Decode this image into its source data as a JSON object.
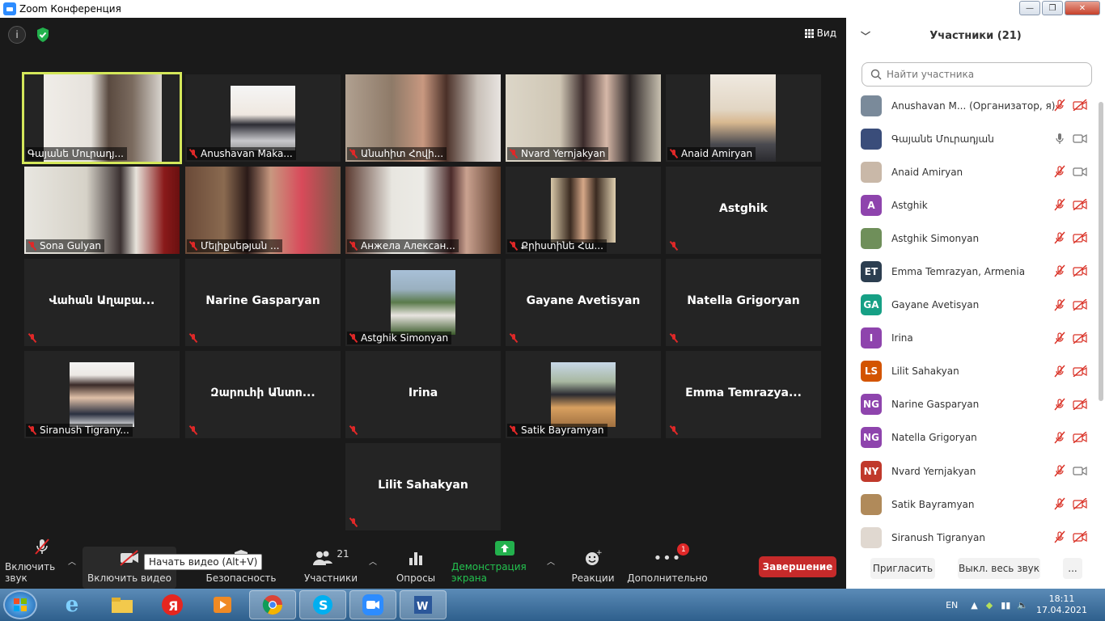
{
  "window": {
    "title": "Zoom Конференция",
    "minimize": "—",
    "maximize": "❐",
    "close": "✕"
  },
  "view_label": "Вид",
  "tiles": [
    {
      "name": "Գայանե Մուրադյ..."
    },
    {
      "name": "Anushavan Maka..."
    },
    {
      "name": "Անահիտ Հովի..."
    },
    {
      "name": "Nvard Yernjakyan"
    },
    {
      "name": "Anaid Amiryan"
    },
    {
      "name": "Sona Gulyan"
    },
    {
      "name": "Մելիքսեթյան ..."
    },
    {
      "name": "Анжела Алексан..."
    },
    {
      "name": "Քրիստինե Հա..."
    },
    {
      "name": "Astghik"
    },
    {
      "name": "Վահան Աղաբա..."
    },
    {
      "name": "Narine Gasparyan"
    },
    {
      "name": "Astghik Simonyan"
    },
    {
      "name": "Gayane Avetisyan"
    },
    {
      "name": "Natella Grigoryan"
    },
    {
      "name": "Siranush Tigrany..."
    },
    {
      "name": "Զարուհի Անտո..."
    },
    {
      "name": "Irina"
    },
    {
      "name": "Satik Bayramyan"
    },
    {
      "name": "Emma  Temrazya..."
    },
    {
      "name": "Lilit Sahakyan"
    }
  ],
  "toolbar": {
    "audio": "Включить звук",
    "video": "Включить видео",
    "tooltip": "Начать видео (Alt+V)",
    "security": "Безопасность",
    "participants": "Участники",
    "participants_count": "21",
    "polls": "Опросы",
    "share": "Демонстрация экрана",
    "reactions": "Реакции",
    "more": "Дополнительно",
    "more_badge": "1",
    "end": "Завершение"
  },
  "panel": {
    "title": "Участники (21)",
    "search_placeholder": "Найти участника",
    "participants": [
      {
        "name": "Anushavan M...  (Организатор, я)",
        "initials": "",
        "color": "#7a8a9a",
        "mic": "off",
        "video": "off"
      },
      {
        "name": "Գայանե Մուրադյան",
        "initials": "",
        "color": "#3a4d7a",
        "mic": "on",
        "video": "on"
      },
      {
        "name": "Anaid Amiryan",
        "initials": "",
        "color": "#c9b8a8",
        "mic": "off",
        "video": "on"
      },
      {
        "name": "Astghik",
        "initials": "A",
        "color": "#8e44ad",
        "mic": "off",
        "video": "off"
      },
      {
        "name": "Astghik Simonyan",
        "initials": "",
        "color": "#6f8f5a",
        "mic": "off",
        "video": "off"
      },
      {
        "name": "Emma  Temrazyan, Armenia",
        "initials": "ET",
        "color": "#2c3e50",
        "mic": "off",
        "video": "off"
      },
      {
        "name": "Gayane Avetisyan",
        "initials": "GA",
        "color": "#16a085",
        "mic": "off",
        "video": "off"
      },
      {
        "name": "Irina",
        "initials": "I",
        "color": "#8e44ad",
        "mic": "off",
        "video": "off"
      },
      {
        "name": "Lilit Sahakyan",
        "initials": "LS",
        "color": "#d35400",
        "mic": "off",
        "video": "off"
      },
      {
        "name": "Narine Gasparyan",
        "initials": "NG",
        "color": "#8e44ad",
        "mic": "off",
        "video": "off"
      },
      {
        "name": "Natella Grigoryan",
        "initials": "NG",
        "color": "#8e44ad",
        "mic": "off",
        "video": "off"
      },
      {
        "name": "Nvard Yernjakyan",
        "initials": "NY",
        "color": "#c0392b",
        "mic": "off",
        "video": "on"
      },
      {
        "name": "Satik Bayramyan",
        "initials": "",
        "color": "#b08a5a",
        "mic": "off",
        "video": "off"
      },
      {
        "name": "Siranush Tigranyan",
        "initials": "",
        "color": "#e0d8d0",
        "mic": "off",
        "video": "off"
      }
    ],
    "invite": "Пригласить",
    "mute_all": "Выкл. весь звук",
    "more": "..."
  },
  "taskbar": {
    "lang": "EN",
    "time": "18:11",
    "date": "17.04.2021"
  }
}
